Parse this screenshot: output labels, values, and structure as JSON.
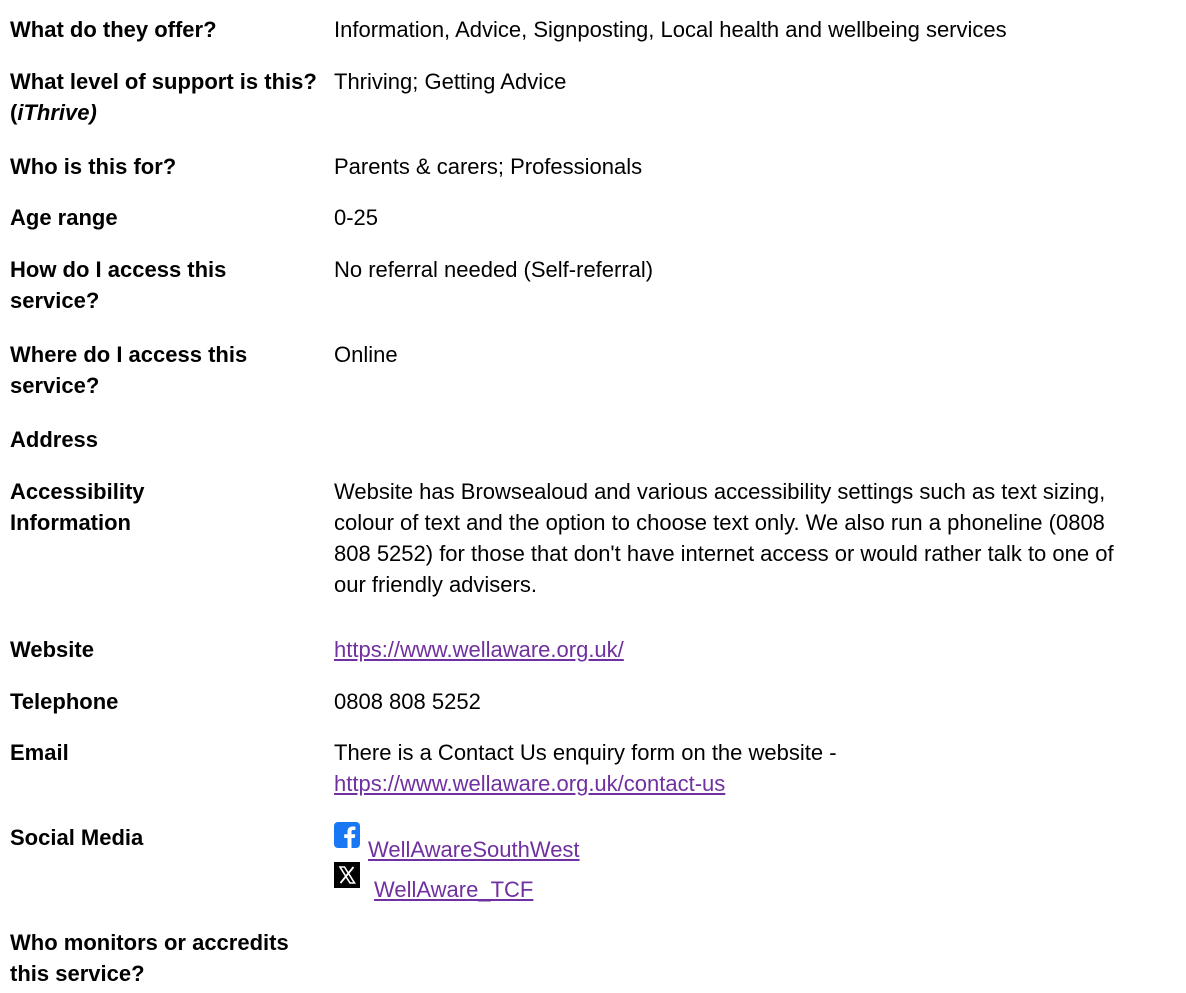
{
  "rows": {
    "offer": {
      "label": "What do they offer?",
      "value": "Information, Advice, Signposting, Local health and wellbeing services"
    },
    "level": {
      "label_prefix": "What level of support is this? (",
      "label_italic": "iThrive)",
      "value": "Thriving; Getting Advice"
    },
    "audience": {
      "label": "Who is this for?",
      "value": "Parents & carers; Professionals"
    },
    "age": {
      "label": "Age range",
      "value": "0-25"
    },
    "access_how": {
      "label": "How do I access this service?",
      "value": "No referral needed (Self-referral)"
    },
    "access_where": {
      "label": "Where do I access this service?",
      "value": "Online"
    },
    "address": {
      "label": "Address",
      "value": ""
    },
    "accessibility": {
      "label": "Accessibility Information",
      "value": "Website has Browsealoud and various accessibility settings such as text sizing, colour of text and the option to choose text only. We also run a phoneline (0808 808 5252) for those that don't have internet access or would rather talk to one of our friendly advisers."
    },
    "website": {
      "label": "Website",
      "link": "https://www.wellaware.org.uk/"
    },
    "telephone": {
      "label": "Telephone",
      "value": "0808 808 5252"
    },
    "email": {
      "label": "Email",
      "value": "There is a Contact Us enquiry form on the website -",
      "link": "https://www.wellaware.org.uk/contact-us"
    },
    "social": {
      "label": "Social Media",
      "facebook": "WellAwareSouthWest",
      "x": "WellAware_TCF",
      "facebook_icon": "facebook-icon",
      "x_icon": "x-icon"
    },
    "monitor": {
      "label": "Who monitors or accredits this service?",
      "value": ""
    }
  },
  "colors": {
    "link": "#7030a0",
    "facebook": "#1877f2",
    "x": "#000000"
  }
}
